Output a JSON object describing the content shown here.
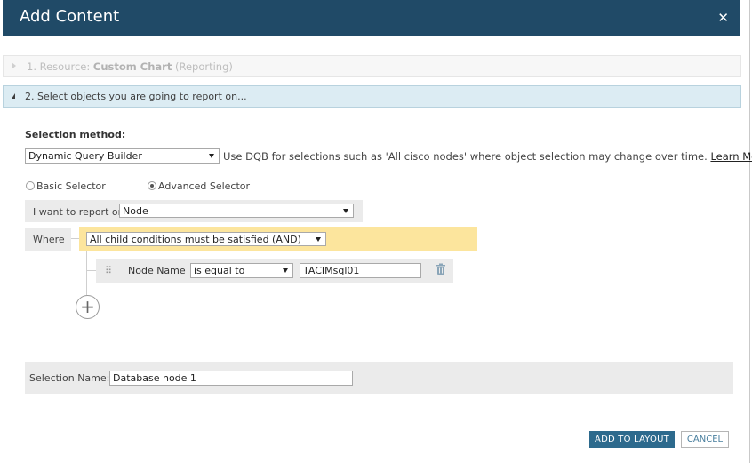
{
  "dialog": {
    "title": "Add Content"
  },
  "step1": {
    "prefix": "1. Resource: ",
    "resource": "Custom Chart",
    "suffix": " (Reporting)"
  },
  "step2": {
    "label": "2. Select objects you are going to report on..."
  },
  "selection_method": {
    "label": "Selection method:",
    "selected": "Dynamic Query Builder",
    "description": "Use DQB for selections such as 'All cisco nodes' where object selection may change over time.",
    "learn_more": "Learn More"
  },
  "selector_mode": {
    "basic": {
      "label": "Basic Selector",
      "checked": false
    },
    "advanced": {
      "label": "Advanced Selector",
      "checked": true
    }
  },
  "report_on": {
    "label": "I want to report on",
    "selected": "Node"
  },
  "where": {
    "label": "Where",
    "group_condition": "All child conditions must be satisfied (AND)"
  },
  "rule": {
    "field": "Node Name",
    "operator": "is equal to",
    "value": "TACIMsql01",
    "drag_handle": "⠿",
    "delete_icon": "trash-icon"
  },
  "add_condition_icon": "plus-icon",
  "selection_name": {
    "label": "Selection Name:",
    "value": "Database node 1"
  },
  "buttons": {
    "add_to_layout": "ADD TO LAYOUT",
    "cancel": "CANCEL"
  },
  "colors": {
    "titlebar": "#204a67",
    "primary_button": "#2d6a8d",
    "condition_band": "#fce59d",
    "active_step": "#dcecf3"
  }
}
